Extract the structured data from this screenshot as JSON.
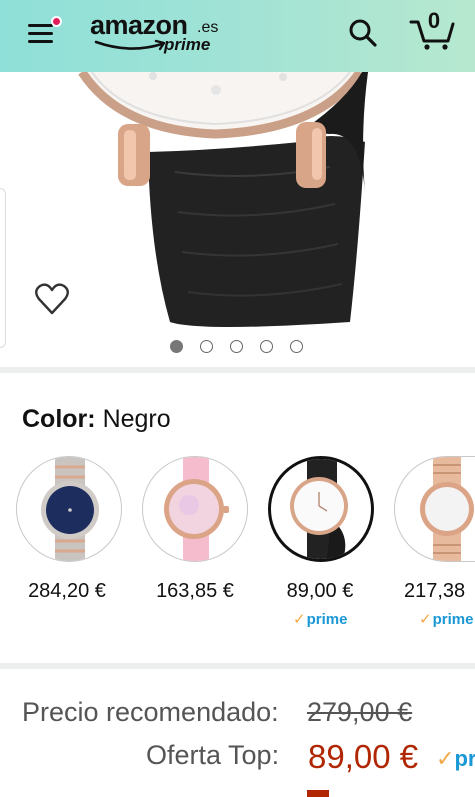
{
  "header": {
    "logo_word": "amazon",
    "logo_tld": ".es",
    "logo_prime": "prime",
    "cart_count": "0",
    "icons": {
      "menu": "hamburger-menu-icon",
      "search": "search-icon",
      "cart": "cart-icon"
    },
    "colors": {
      "gradient_start": "#8fe0d8",
      "gradient_end": "#b7e8cf",
      "notification_dot": "#e31e5a"
    }
  },
  "gallery": {
    "image": "watch-black-strap-rose-gold",
    "total_images": 5,
    "active_index": 0,
    "wishlist_icon": "heart-outline-icon"
  },
  "color": {
    "label": "Color:",
    "selected": "Negro",
    "options": [
      {
        "price": "284,20 €",
        "prime": false,
        "selected": false,
        "thumb": "watch-silver-rose-bracelet-blue-dial"
      },
      {
        "price": "163,85 €",
        "prime": false,
        "selected": false,
        "thumb": "watch-pink-strap-pearl-dial"
      },
      {
        "price": "89,00 €",
        "prime": true,
        "selected": true,
        "thumb": "watch-black-strap-white-dial"
      },
      {
        "price": "217,38",
        "prime": true,
        "selected": false,
        "thumb": "watch-rose-gold-bracelet-white-dial"
      }
    ],
    "prime_text": "prime"
  },
  "pricing": {
    "recommended_label": "Precio recomendado:",
    "recommended_value": "279,00 €",
    "offer_label": "Oferta Top:",
    "offer_value": "89,00 €",
    "offer_prime": "pr",
    "colors": {
      "offer": "#b12704",
      "prime": "#1a98d5",
      "prime_check": "#f3a847"
    }
  }
}
